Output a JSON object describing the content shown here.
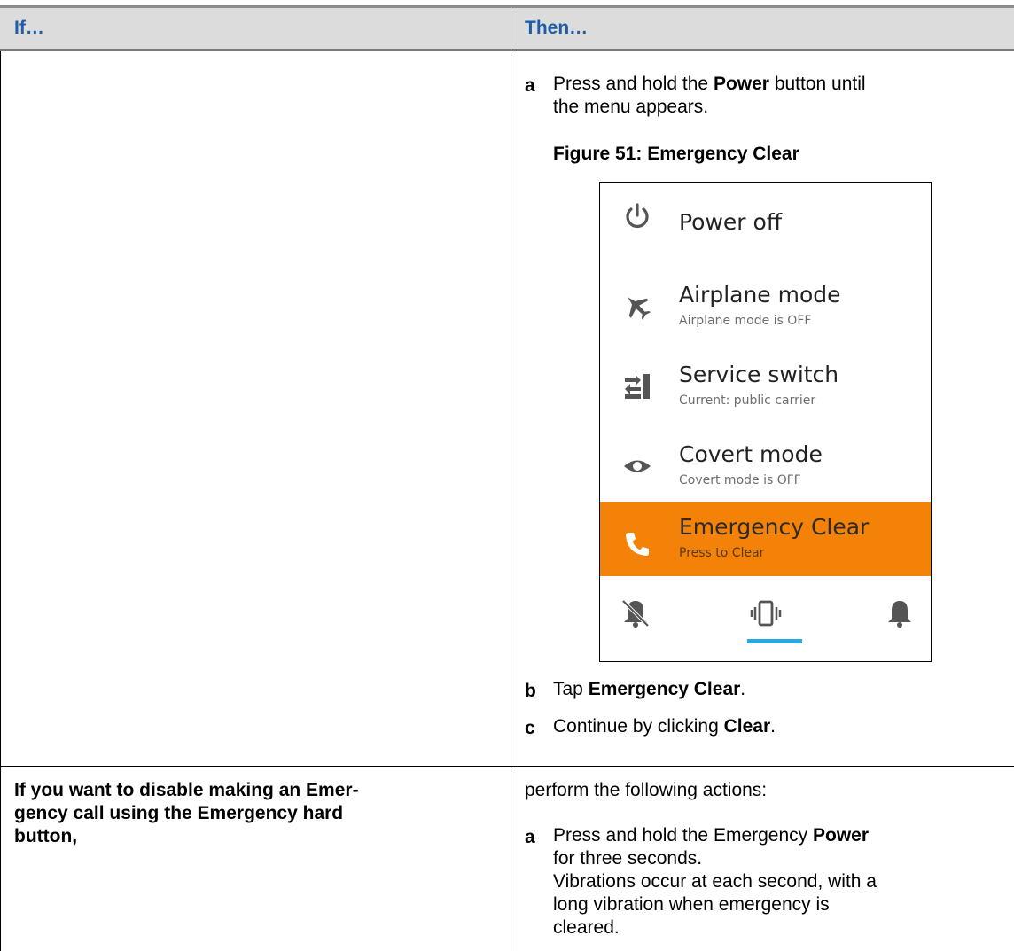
{
  "table": {
    "headers": {
      "if": "If…",
      "then": "Then…"
    },
    "row1": {
      "step_a": {
        "letter": "a",
        "pre": "Press and hold the ",
        "bold": "Power",
        "post": " button until",
        "line2": "the menu appears."
      },
      "figure_caption": "Figure 51: Emergency Clear",
      "phone_menu": {
        "items": [
          {
            "icon": "power-icon",
            "title": "Power off",
            "subtitle": ""
          },
          {
            "icon": "airplane-icon",
            "title": "Airplane mode",
            "subtitle": "Airplane mode is OFF"
          },
          {
            "icon": "service-switch-icon",
            "title": "Service switch",
            "subtitle": "Current: public carrier"
          },
          {
            "icon": "eye-icon",
            "title": "Covert mode",
            "subtitle": "Covert mode is OFF"
          },
          {
            "icon": "phone-icon",
            "title": "Emergency Clear",
            "subtitle": "Press to Clear",
            "highlighted": true
          }
        ],
        "sound_modes": [
          "mute-bell-icon",
          "vibrate-icon",
          "bell-icon"
        ],
        "selected_sound_mode": "vibrate-icon",
        "highlight_color": "#f48208",
        "indicator_color": "#29a8e0"
      },
      "step_b": {
        "letter": "b",
        "pre": "Tap ",
        "bold": "Emergency Clear",
        "post": "."
      },
      "step_c": {
        "letter": "c",
        "pre": "Continue by clicking ",
        "bold": "Clear",
        "post": "."
      }
    },
    "row2": {
      "if_lines": [
        "If you want to disable making an Emer-",
        "gency call using the Emergency hard",
        "button,"
      ],
      "then_intro": "perform the following actions:",
      "step_a": {
        "letter": "a",
        "pre": "Press and hold the Emergency ",
        "bold": "Power",
        "line2": "for three seconds.",
        "line3": "Vibrations occur at each second, with a",
        "line4": "long vibration when emergency is",
        "line5": "cleared."
      }
    }
  },
  "colors": {
    "header_text": "#1c5ea8",
    "header_bg": "#dcdcdc"
  }
}
